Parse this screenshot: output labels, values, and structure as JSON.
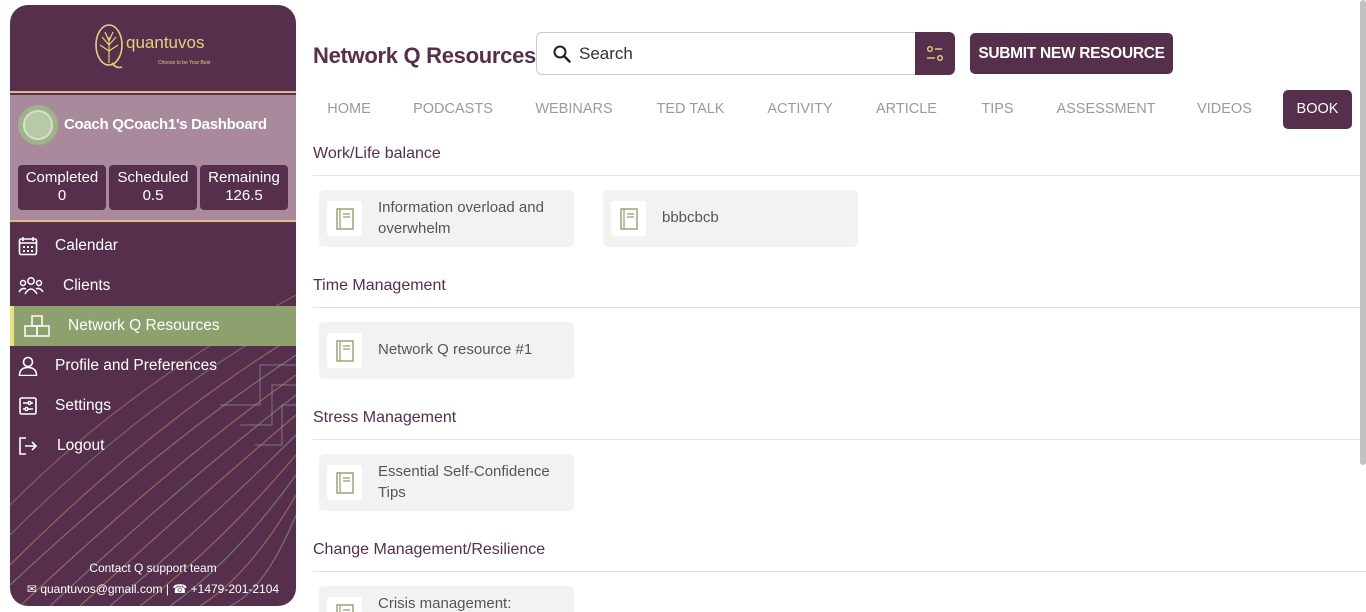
{
  "app": {
    "logo_text": "quantuvos",
    "logo_tagline": "Choose to be Your Best"
  },
  "profile": {
    "dashboard_title": "Coach QCoach1's Dashboard",
    "stats": [
      {
        "label": "Completed",
        "value": "0"
      },
      {
        "label": "Scheduled",
        "value": "0.5"
      },
      {
        "label": "Remaining",
        "value": "126.5"
      }
    ]
  },
  "nav": {
    "items": [
      {
        "label": "Calendar",
        "icon": "calendar-icon"
      },
      {
        "label": "Clients",
        "icon": "users-icon"
      },
      {
        "label": "Network Q Resources",
        "icon": "boxes-icon",
        "active": true
      },
      {
        "label": "Profile and Preferences",
        "icon": "user-icon"
      },
      {
        "label": "Settings",
        "icon": "settings-icon"
      },
      {
        "label": "Logout",
        "icon": "logout-icon"
      }
    ]
  },
  "contact": {
    "title": "Contact Q support team",
    "email": "quantuvos@gmail.com",
    "phone": "+1479-201-2104"
  },
  "header": {
    "title": "Network Q Resources",
    "search_placeholder": "Search",
    "submit_label": "SUBMIT NEW RESOURCE"
  },
  "tabs": [
    {
      "label": "HOME"
    },
    {
      "label": "PODCASTS"
    },
    {
      "label": "WEBINARS"
    },
    {
      "label": "TED TALK"
    },
    {
      "label": "ACTIVITY"
    },
    {
      "label": "ARTICLE"
    },
    {
      "label": "TIPS"
    },
    {
      "label": "ASSESSMENT"
    },
    {
      "label": "VIDEOS"
    },
    {
      "label": "BOOK",
      "active": true
    }
  ],
  "sections": [
    {
      "title": "Work/Life balance",
      "cards": [
        "Information overload and overwhelm",
        "bbbcbcb"
      ]
    },
    {
      "title": "Time Management",
      "cards": [
        "Network Q resource #1"
      ]
    },
    {
      "title": "Stress Management",
      "cards": [
        "Essential Self-Confidence Tips"
      ]
    },
    {
      "title": "Change Management/Resilience",
      "cards": [
        "Crisis management:"
      ]
    }
  ],
  "colors": {
    "brand": "#552f4b",
    "active_nav": "#8ea06e",
    "accent_gold": "#e8cf7d"
  }
}
